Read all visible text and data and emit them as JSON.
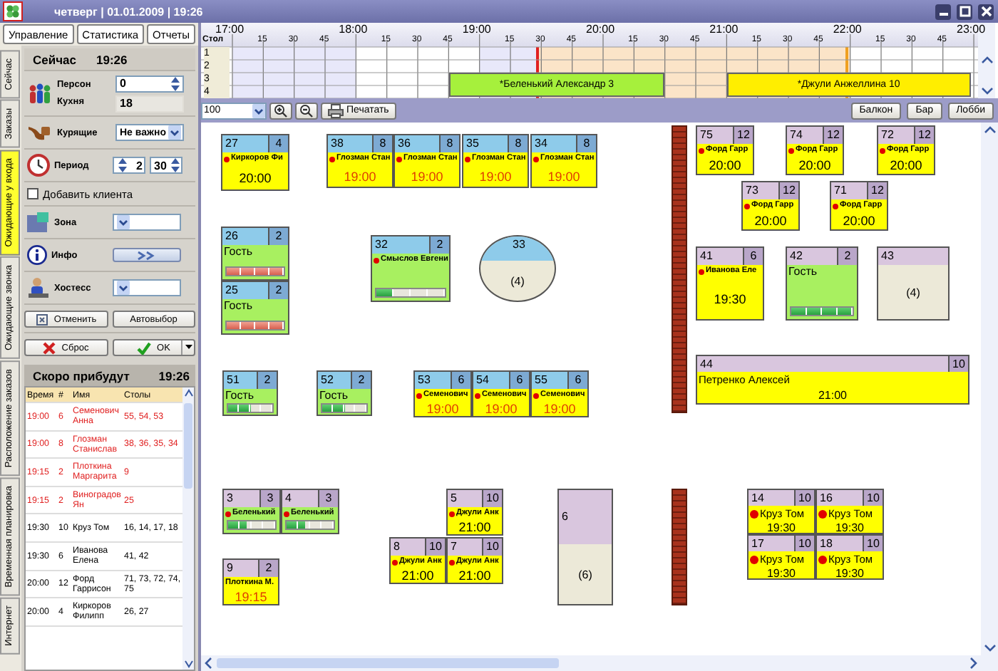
{
  "window": {
    "title": "четверг | 01.01.2009 | 19:26"
  },
  "menu_buttons": [
    "Управление",
    "Статистика",
    "Отчеты"
  ],
  "side_tabs": [
    {
      "label": "Сейчас",
      "selected": false
    },
    {
      "label": "Заказы",
      "selected": false
    },
    {
      "label": "Ожидающие у входа",
      "selected": true
    },
    {
      "label": "Ожидающие звонка",
      "selected": false
    },
    {
      "label": "Расположение заказов",
      "selected": false
    },
    {
      "label": "Временная планировка",
      "selected": false
    },
    {
      "label": "Интернет",
      "selected": false
    }
  ],
  "now_panel": {
    "title": "Сейчас",
    "time": "19:26",
    "persons": {
      "label": "Персон",
      "value": "0"
    },
    "kitchen": {
      "label": "Кухня",
      "value": "18"
    },
    "smoking": {
      "label": "Курящие",
      "value": "Не важно"
    },
    "period": {
      "label": "Период",
      "hours": "2",
      "minutes": "30"
    },
    "add_client": {
      "label": "Добавить клиента",
      "checked": false
    },
    "zone": {
      "label": "Зона"
    },
    "info": {
      "label": "Инфо"
    },
    "hostess": {
      "label": "Хостесс"
    },
    "buttons": {
      "cancel": "Отменить",
      "auto": "Автовыбор",
      "reset": "Сброс",
      "ok": "OK"
    }
  },
  "arriving": {
    "title": "Скоро прибудут",
    "time": "19:26",
    "columns": [
      "Время",
      "#",
      "Имя",
      "Столы"
    ],
    "rows": [
      {
        "time": "19:00",
        "count": "6",
        "name": "Семенович Анна",
        "tables": "55, 54, 53",
        "late": true
      },
      {
        "time": "19:00",
        "count": "8",
        "name": "Глозман Станислав",
        "tables": "38, 36, 35, 34",
        "late": true
      },
      {
        "time": "19:15",
        "count": "2",
        "name": "Плоткина Маргарита",
        "tables": "9",
        "late": true
      },
      {
        "time": "19:15",
        "count": "2",
        "name": "Виноградов Ян",
        "tables": "25",
        "late": true
      },
      {
        "time": "19:30",
        "count": "10",
        "name": "Круз Том",
        "tables": "16, 14, 17, 18",
        "late": false
      },
      {
        "time": "19:30",
        "count": "6",
        "name": "Иванова Елена",
        "tables": "41, 42",
        "late": false
      },
      {
        "time": "20:00",
        "count": "12",
        "name": "Форд Гаррисон",
        "tables": "71, 73, 72, 74, 75",
        "late": false
      },
      {
        "time": "20:00",
        "count": "4",
        "name": "Киркоров Филипп",
        "tables": "26, 27",
        "late": false
      }
    ]
  },
  "timeline": {
    "column_label": "Стол",
    "hours": [
      {
        "label": "17:00",
        "minutes": [
          "15",
          "30",
          "45"
        ]
      },
      {
        "label": "18:00",
        "minutes": [
          "15",
          "30",
          "45"
        ]
      },
      {
        "label": "19:00",
        "minutes": [
          "15",
          "30",
          "45"
        ]
      },
      {
        "label": "20:00",
        "minutes": [
          "15",
          "30",
          "45"
        ]
      },
      {
        "label": "21:00",
        "minutes": [
          "15",
          "30",
          "45"
        ]
      },
      {
        "label": "22:00",
        "minutes": [
          "15",
          "30",
          "45"
        ]
      },
      {
        "label": "23:00"
      }
    ],
    "rows": [
      "1",
      "2",
      "3",
      "4"
    ],
    "bookings": [
      {
        "label": "*Беленький Александр 3",
        "color": "#a6f03c"
      },
      {
        "label": "*Джули Анжеллина 10",
        "color": "#ffee00"
      }
    ]
  },
  "toolbar": {
    "zoom": "100",
    "print": "Печатать",
    "zones": [
      "Балкон",
      "Бар",
      "Лобби"
    ]
  },
  "tables": [
    {
      "number": "27",
      "seats": "4",
      "color": "#8ecbea",
      "kind": "reserved",
      "alert": true,
      "name": "Киркоров Фи",
      "time": "20:00",
      "late": false
    },
    {
      "number": "38",
      "seats": "8",
      "color": "#8ecbea",
      "kind": "reserved",
      "alert": true,
      "name": "Глозман Стан",
      "time": "19:00",
      "late": true
    },
    {
      "number": "36",
      "seats": "8",
      "color": "#8ecbea",
      "kind": "reserved",
      "alert": true,
      "name": "Глозман Стан",
      "time": "19:00",
      "late": true
    },
    {
      "number": "35",
      "seats": "8",
      "color": "#8ecbea",
      "kind": "reserved",
      "alert": true,
      "name": "Глозман Стан",
      "time": "19:00",
      "late": true
    },
    {
      "number": "34",
      "seats": "8",
      "color": "#8ecbea",
      "kind": "reserved",
      "alert": true,
      "name": "Глозман Стан",
      "time": "19:00",
      "late": true
    },
    {
      "number": "75",
      "seats": "12",
      "color": "#d9c6de",
      "kind": "reserved",
      "alert": true,
      "name": "Форд Гарр",
      "time": "20:00",
      "late": false
    },
    {
      "number": "74",
      "seats": "12",
      "color": "#d9c6de",
      "kind": "reserved",
      "alert": true,
      "name": "Форд Гарр",
      "time": "20:00",
      "late": false
    },
    {
      "number": "72",
      "seats": "12",
      "color": "#d9c6de",
      "kind": "reserved",
      "alert": true,
      "name": "Форд Гарр",
      "time": "20:00",
      "late": false
    },
    {
      "number": "73",
      "seats": "12",
      "color": "#d9c6de",
      "kind": "reserved",
      "alert": true,
      "name": "Форд Гарр",
      "time": "20:00",
      "late": false
    },
    {
      "number": "71",
      "seats": "12",
      "color": "#d9c6de",
      "kind": "reserved",
      "alert": true,
      "name": "Форд Гарр",
      "time": "20:00",
      "late": false
    },
    {
      "number": "26",
      "seats": "2",
      "color": "#8ecbea",
      "kind": "guest",
      "label": "Гость",
      "level": 1,
      "overdue": true
    },
    {
      "number": "25",
      "seats": "2",
      "color": "#8ecbea",
      "kind": "guest",
      "label": "Гость",
      "level": 1,
      "overdue": true
    },
    {
      "number": "32",
      "seats": "2",
      "color": "#8ecbea",
      "kind": "seated",
      "alert": true,
      "name": "Смыслов Евгени",
      "level": 0.25,
      "overdue": false
    },
    {
      "number": "33",
      "color": "#8ecbea",
      "kind": "free",
      "free_seats": "(4)"
    },
    {
      "number": "41",
      "seats": "6",
      "color": "#d9c6de",
      "kind": "reserved",
      "alert": true,
      "name": "Иванова Еле",
      "time": "19:30",
      "late": false
    },
    {
      "number": "42",
      "seats": "2",
      "color": "#d9c6de",
      "kind": "guest",
      "label": "Гость",
      "level": 1,
      "overdue": false
    },
    {
      "number": "43",
      "color": "#d9c6de",
      "kind": "free",
      "free_seats": "(4)"
    },
    {
      "number": "51",
      "seats": "2",
      "color": "#8ecbea",
      "kind": "guest",
      "label": "Гость",
      "level": 0.5,
      "overdue": false
    },
    {
      "number": "52",
      "seats": "2",
      "color": "#8ecbea",
      "kind": "guest",
      "label": "Гость",
      "level": 0.5,
      "overdue": false
    },
    {
      "number": "53",
      "seats": "6",
      "color": "#8ecbea",
      "kind": "reserved",
      "alert": true,
      "name": "Семенович",
      "time": "19:00",
      "late": true
    },
    {
      "number": "54",
      "seats": "6",
      "color": "#8ecbea",
      "kind": "reserved",
      "alert": true,
      "name": "Семенович",
      "time": "19:00",
      "late": true
    },
    {
      "number": "55",
      "seats": "6",
      "color": "#8ecbea",
      "kind": "reserved",
      "alert": true,
      "name": "Семенович",
      "time": "19:00",
      "late": true
    },
    {
      "number": "44",
      "seats": "10",
      "color": "#d9c6de",
      "kind": "reserved",
      "alert": false,
      "name": "Петренко Алексей",
      "time": "21:00",
      "late": false
    },
    {
      "number": "3",
      "seats": "3",
      "color": "#d9c6de",
      "kind": "seated",
      "alert": true,
      "name": "Беленький",
      "level": 0.4,
      "overdue": false
    },
    {
      "number": "4",
      "seats": "3",
      "color": "#d9c6de",
      "kind": "seated",
      "alert": true,
      "name": "Беленький",
      "level": 0.4,
      "overdue": false
    },
    {
      "number": "5",
      "seats": "10",
      "color": "#d9c6de",
      "kind": "reserved",
      "alert": true,
      "name": "Джули Анк",
      "time": "21:00",
      "late": false
    },
    {
      "number": "8",
      "seats": "10",
      "color": "#d9c6de",
      "kind": "reserved",
      "alert": true,
      "name": "Джули Анк",
      "time": "21:00",
      "late": false
    },
    {
      "number": "7",
      "seats": "10",
      "color": "#d9c6de",
      "kind": "reserved",
      "alert": true,
      "name": "Джули Анк",
      "time": "21:00",
      "late": false
    },
    {
      "number": "6",
      "color": "#d9c6de",
      "kind": "free",
      "free_seats": "(6)"
    },
    {
      "number": "14",
      "seats": "10",
      "color": "#d9c6de",
      "kind": "reserved",
      "alert": true,
      "name": "Круз Том",
      "time": "19:30",
      "late": false
    },
    {
      "number": "16",
      "seats": "10",
      "color": "#d9c6de",
      "kind": "reserved",
      "alert": true,
      "name": "Круз Том",
      "time": "19:30",
      "late": false
    },
    {
      "number": "17",
      "seats": "10",
      "color": "#d9c6de",
      "kind": "reserved",
      "alert": true,
      "name": "Круз Том",
      "time": "19:30",
      "late": false
    },
    {
      "number": "18",
      "seats": "10",
      "color": "#d9c6de",
      "kind": "reserved",
      "alert": true,
      "name": "Круз Том",
      "time": "19:30",
      "late": false
    },
    {
      "number": "9",
      "seats": "2",
      "color": "#d9c6de",
      "kind": "reserved",
      "alert": false,
      "name": "Плоткина М.",
      "time": "19:15",
      "late": true
    }
  ]
}
